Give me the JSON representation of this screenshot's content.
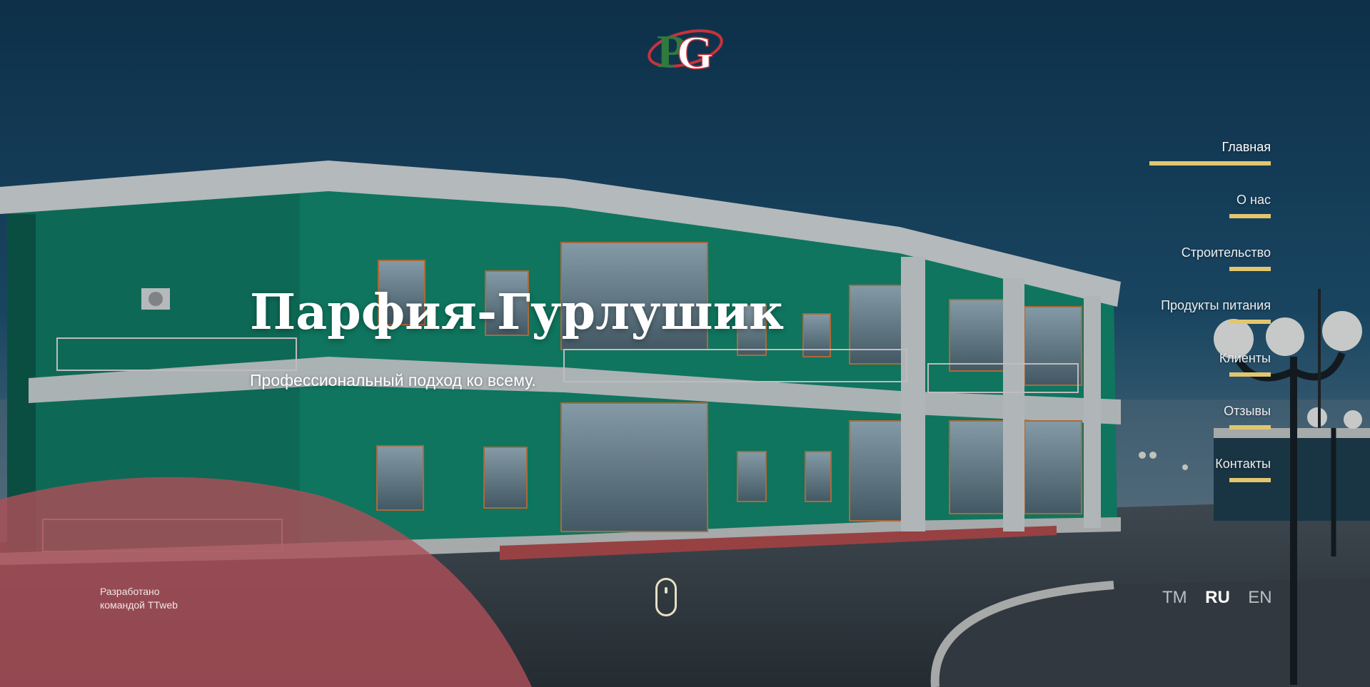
{
  "brand": {
    "logo_letters": "PG"
  },
  "hero": {
    "title": "Парфия-Гурлушик",
    "subtitle": "Профессиональный подход ко всему."
  },
  "nav": {
    "items": [
      {
        "label": "Главная",
        "active": true
      },
      {
        "label": "О нас"
      },
      {
        "label": "Строительство"
      },
      {
        "label": "Продукты питания"
      },
      {
        "label": "Клиенты"
      },
      {
        "label": "Отзывы"
      },
      {
        "label": "Контакты"
      }
    ]
  },
  "footer": {
    "credit_line1": "Разработано",
    "credit_line2": "командой TTweb",
    "scroll_icon": "mouse-icon"
  },
  "languages": [
    {
      "code": "TM"
    },
    {
      "code": "RU",
      "active": true
    },
    {
      "code": "EN"
    }
  ],
  "colors": {
    "accent": "#e2c66f",
    "building_green": "#0f8a6a",
    "sky": "#123a55",
    "red_overlay": "#c8505a"
  }
}
